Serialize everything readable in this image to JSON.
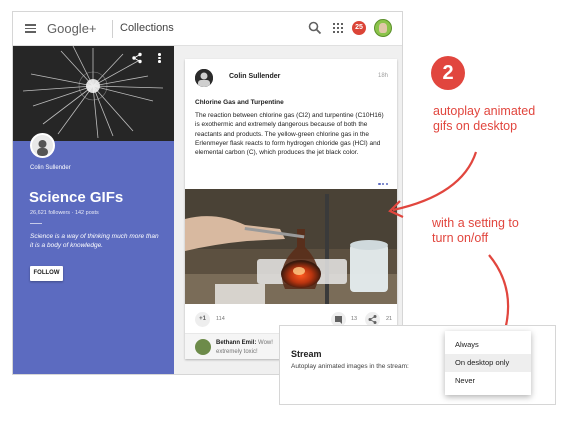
{
  "topbar": {
    "brand": "Google+",
    "title": "Collections",
    "notification_count": "25"
  },
  "collection": {
    "owner": "Colin Sullender",
    "title": "Science GIFs",
    "stats": "26,621 followers · 142 posts",
    "description": "Science is a way of thinking much more than it is a body of knowledge.",
    "follow_label": "FOLLOW"
  },
  "post": {
    "author": "Colin Sullender",
    "time": "18h",
    "title": "Chlorine Gas and Turpentine",
    "body": "The reaction between chlorine gas (Cl2) and turpentine (C10H16) is exothermic and extremely dangerous because of both the reactants and products. The yellow-green chlorine gas in the Erlenmeyer flask reacts to form hydrogen chloride gas (HCl) and elemental carbon (C), which produces the jet black color.",
    "plus_label": "+1",
    "plus_count": "114",
    "comment_count": "13",
    "share_count": "21",
    "comment": {
      "author": "Bethann Emil:",
      "text": "Wow! extremely toxic!"
    }
  },
  "annotations": {
    "badge": "2",
    "line1": "autoplay animated",
    "line2": "gifs on desktop",
    "line3": "with a setting to",
    "line4": "turn on/off",
    "color": "#e1463e"
  },
  "settings": {
    "title": "Stream",
    "description": "Autoplay animated images in the stream:",
    "options": [
      "Always",
      "On desktop only",
      "Never"
    ],
    "selected": "On desktop only"
  },
  "colors": {
    "collection_bg": "#5c6bc0",
    "accent_red": "#e1463e"
  }
}
